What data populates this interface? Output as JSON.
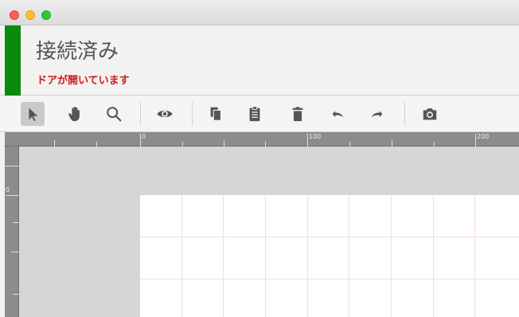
{
  "window": {
    "controls": [
      "close",
      "minimize",
      "zoom"
    ]
  },
  "status": {
    "title": "接続済み",
    "message": "ドアが開いています",
    "indicator_color": "#0b8a0b",
    "message_color": "#d11a1a"
  },
  "toolbar": {
    "tools": [
      {
        "name": "select",
        "icon": "arrow-pointer-icon",
        "active": true
      },
      {
        "name": "pan",
        "icon": "hand-icon",
        "active": false
      },
      {
        "name": "zoom",
        "icon": "magnifier-icon",
        "active": false
      },
      {
        "name": "preview",
        "icon": "eye-icon",
        "active": false
      },
      {
        "name": "copy",
        "icon": "copy-icon",
        "active": false
      },
      {
        "name": "paste",
        "icon": "clipboard-icon",
        "active": false
      },
      {
        "name": "delete",
        "icon": "trash-icon",
        "active": false
      },
      {
        "name": "undo",
        "icon": "undo-icon",
        "active": false
      },
      {
        "name": "redo",
        "icon": "redo-icon",
        "active": false
      },
      {
        "name": "snapshot",
        "icon": "camera-icon",
        "active": false
      }
    ]
  },
  "ruler": {
    "h_labels": [
      "0",
      "100",
      "200"
    ],
    "v_labels": [
      "0"
    ]
  }
}
